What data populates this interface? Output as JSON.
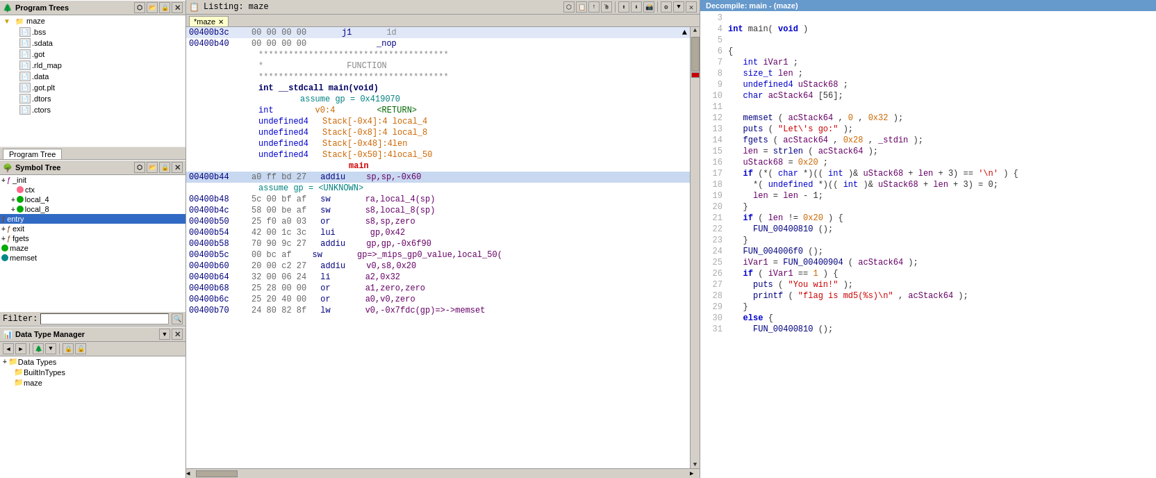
{
  "leftPanel": {
    "programTrees": {
      "title": "Program Trees",
      "items": [
        {
          "label": "maze",
          "type": "folder",
          "level": 0
        },
        {
          "label": ".bss",
          "type": "file",
          "level": 1
        },
        {
          "label": ".sdata",
          "type": "file",
          "level": 1
        },
        {
          "label": ".got",
          "type": "file",
          "level": 1
        },
        {
          "label": ".rld_map",
          "type": "file",
          "level": 1
        },
        {
          "label": ".data",
          "type": "file",
          "level": 1
        },
        {
          "label": ".got.plt",
          "type": "file",
          "level": 1
        },
        {
          "label": ".dtors",
          "type": "file",
          "level": 1
        },
        {
          "label": ".ctors",
          "type": "file",
          "level": 1
        }
      ],
      "tab": "Program Tree"
    },
    "symbolTree": {
      "title": "Symbol Tree",
      "items": [
        {
          "label": "_init",
          "type": "func_exp",
          "level": 0
        },
        {
          "label": "ctx",
          "type": "dot_pink",
          "level": 1
        },
        {
          "label": "local_4",
          "type": "dot_green_exp",
          "level": 1
        },
        {
          "label": "local_8",
          "type": "dot_green_exp",
          "level": 1
        },
        {
          "label": "entry",
          "type": "selected",
          "level": 0
        },
        {
          "label": "exit",
          "type": "func_exp",
          "level": 0
        },
        {
          "label": "fgets",
          "type": "func_exp",
          "level": 0
        },
        {
          "label": "maze",
          "type": "dot_green",
          "level": 0
        },
        {
          "label": "memset",
          "type": "dot_teal",
          "level": 0
        }
      ],
      "filterLabel": "Filter:",
      "filterPlaceholder": ""
    },
    "dataTypeManager": {
      "title": "Data Type Manager",
      "items": [
        {
          "label": "Data Types",
          "level": 0
        },
        {
          "label": "BuiltInTypes",
          "level": 1
        },
        {
          "label": "maze",
          "level": 1
        }
      ]
    }
  },
  "middlePanel": {
    "title": "Listing:  maze",
    "tab": "*maze",
    "lines": [
      {
        "addr": "00400b3c",
        "bytes": "00 00 00 00",
        "mnem": "j1",
        "ops": "",
        "comment": "1d",
        "type": "normal"
      },
      {
        "addr": "00400b40",
        "bytes": "00 00 00 00",
        "mnem": "_nop",
        "ops": "",
        "comment": "",
        "type": "normal"
      },
      {
        "addr": "",
        "bytes": "",
        "mnem": "",
        "ops": "**************************************",
        "comment": "",
        "type": "separator"
      },
      {
        "addr": "",
        "bytes": "",
        "mnem": "*",
        "ops": "",
        "comment": "FUNCTION",
        "type": "function_hdr"
      },
      {
        "addr": "",
        "bytes": "",
        "mnem": "",
        "ops": "**************************************",
        "comment": "",
        "type": "separator"
      },
      {
        "addr": "",
        "bytes": "",
        "mnem": "int __stdcall main(void)",
        "ops": "",
        "comment": "",
        "type": "func_sig"
      },
      {
        "addr": "",
        "bytes": "",
        "mnem": "assume gp = 0x419070",
        "ops": "",
        "comment": "",
        "type": "assume"
      },
      {
        "addr": "",
        "bytes": "",
        "mnem": "int",
        "ops": "v0:4",
        "comment": "<RETURN>",
        "type": "var"
      },
      {
        "addr": "",
        "bytes": "",
        "mnem": "undefined4",
        "ops": "Stack[-0x4]:4 local_4",
        "comment": "",
        "type": "var"
      },
      {
        "addr": "",
        "bytes": "",
        "mnem": "undefined4",
        "ops": "Stack[-0x8]:4 local_8",
        "comment": "",
        "type": "var"
      },
      {
        "addr": "",
        "bytes": "",
        "mnem": "undefined4",
        "ops": "Stack[-0x48]:4len",
        "comment": "",
        "type": "var"
      },
      {
        "addr": "",
        "bytes": "",
        "mnem": "undefined4",
        "ops": "Stack[-0x50]:4local_50",
        "comment": "",
        "type": "var"
      },
      {
        "addr": "",
        "bytes": "",
        "mnem": "main",
        "ops": "",
        "comment": "",
        "type": "label"
      },
      {
        "addr": "00400b44",
        "bytes": "a0 ff bd 27",
        "mnem": "addiu",
        "ops": "sp,sp,-0x60",
        "comment": "",
        "type": "selected"
      },
      {
        "addr": "",
        "bytes": "",
        "mnem": "assume gp = <UNKNOWN>",
        "ops": "",
        "comment": "",
        "type": "assume"
      },
      {
        "addr": "00400b48",
        "bytes": "5c 00 bf af",
        "mnem": "sw",
        "ops": "ra,local_4(sp)",
        "comment": "",
        "type": "normal"
      },
      {
        "addr": "00400b4c",
        "bytes": "58 00 be af",
        "mnem": "sw",
        "ops": "s8,local_8(sp)",
        "comment": "",
        "type": "normal"
      },
      {
        "addr": "00400b50",
        "bytes": "25 f0 a0 03",
        "mnem": "or",
        "ops": "s8,sp,zero",
        "comment": "",
        "type": "normal"
      },
      {
        "addr": "00400b54",
        "bytes": "42 00 1c 3c",
        "mnem": "lui",
        "ops": "gp,0x42",
        "comment": "",
        "type": "normal"
      },
      {
        "addr": "00400b58",
        "bytes": "70 90 9c 27",
        "mnem": "addiu",
        "ops": "gp,gp,-0x6f90",
        "comment": "",
        "type": "normal"
      },
      {
        "addr": "00400b5c",
        "bytes": "00 bc af",
        "mnem": "sw",
        "ops": "gp=>_mips_gp0_value,local_50(",
        "comment": "",
        "type": "normal"
      },
      {
        "addr": "00400b60",
        "bytes": "20 00 c2 27",
        "mnem": "addiu",
        "ops": "v0,s8,0x20",
        "comment": "",
        "type": "normal"
      },
      {
        "addr": "00400b64",
        "bytes": "32 00 06 24",
        "mnem": "li",
        "ops": "a2,0x32",
        "comment": "",
        "type": "normal"
      },
      {
        "addr": "00400b68",
        "bytes": "25 28 00 00",
        "mnem": "or",
        "ops": "a1,zero,zero",
        "comment": "",
        "type": "normal"
      },
      {
        "addr": "00400b6c",
        "bytes": "25 20 40 00",
        "mnem": "or",
        "ops": "a0,v0,zero",
        "comment": "",
        "type": "normal"
      },
      {
        "addr": "00400b70",
        "bytes": "24 80 82 8f",
        "mnem": "lw",
        "ops": "v0,-0x7fdc(gp)=>->memset",
        "comment": "",
        "type": "normal"
      }
    ]
  },
  "rightPanel": {
    "title": "Decompile: main -  (maze)",
    "lines": [
      {
        "no": "3",
        "code": ""
      },
      {
        "no": "4",
        "code": "int_main(void)"
      },
      {
        "no": "5",
        "code": ""
      },
      {
        "no": "6",
        "code": "{"
      },
      {
        "no": "7",
        "code": "  int iVar1;"
      },
      {
        "no": "8",
        "code": "  size_t len;"
      },
      {
        "no": "9",
        "code": "  undefined4 uStack68;"
      },
      {
        "no": "10",
        "code": "  char acStack64 [56];"
      },
      {
        "no": "11",
        "code": ""
      },
      {
        "no": "12",
        "code": "  memset(acStack64,0,0x32);"
      },
      {
        "no": "13",
        "code": "  puts(\"Let\\'s go:\");"
      },
      {
        "no": "14",
        "code": "  fgets(acStack64,0x28,_stdin);"
      },
      {
        "no": "15",
        "code": "  len = strlen(acStack64);"
      },
      {
        "no": "16",
        "code": "  uStack68 = 0x20;"
      },
      {
        "no": "17",
        "code": "  if (*(char *)((int)&uStack68 + len + 3) == '\\n') {"
      },
      {
        "no": "18",
        "code": "    *(undefined *)((int)&uStack68 + len + 3) = 0;"
      },
      {
        "no": "19",
        "code": "    len = len - 1;"
      },
      {
        "no": "20",
        "code": "  }"
      },
      {
        "no": "21",
        "code": "  if (len != 0x20) {"
      },
      {
        "no": "22",
        "code": "    FUN_00400810();"
      },
      {
        "no": "23",
        "code": "  }"
      },
      {
        "no": "24",
        "code": "  FUN_004006f0();"
      },
      {
        "no": "25",
        "code": "  iVar1 = FUN_00400904(acStack64);"
      },
      {
        "no": "26",
        "code": "  if (iVar1 == 1) {"
      },
      {
        "no": "27",
        "code": "    puts(\"You win!\");"
      },
      {
        "no": "28",
        "code": "    printf(\"flag is md5(%s)\\n\",acStack64);"
      },
      {
        "no": "29",
        "code": "  }"
      },
      {
        "no": "30",
        "code": "  else {"
      },
      {
        "no": "31",
        "code": "    FUN_00400810();"
      }
    ]
  },
  "colors": {
    "headerBg": "#d4d0c8",
    "selectedBg": "#c8d8f0",
    "decompileHeaderBg": "#6699cc",
    "tabBg": "#ffffcc"
  }
}
